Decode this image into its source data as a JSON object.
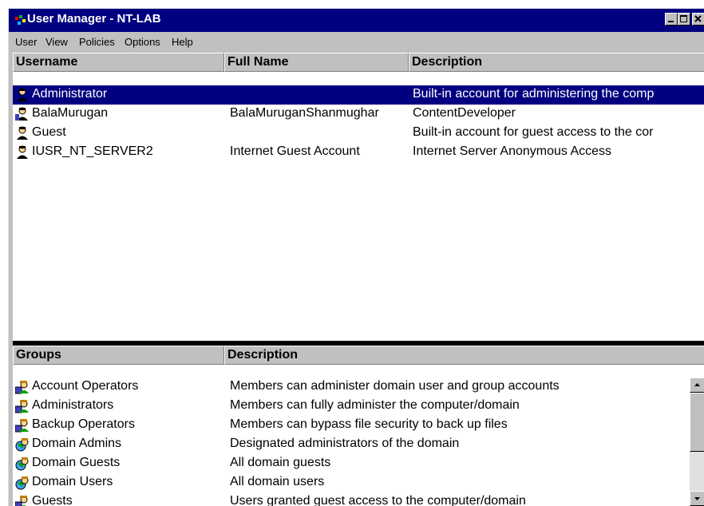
{
  "window": {
    "title": "User Manager - NT-LAB",
    "controls": {
      "minimize_icon": "minimize-icon",
      "maximize_icon": "maximize-icon",
      "close_icon": "close-icon"
    }
  },
  "menu": {
    "items": [
      {
        "label": "User"
      },
      {
        "label": "View"
      },
      {
        "label": "Policies"
      },
      {
        "label": "Options"
      },
      {
        "label": "Help"
      }
    ]
  },
  "users": {
    "columns": [
      "Username",
      "Full Name",
      "Description"
    ],
    "rows": [
      {
        "username": "Administrator",
        "full_name": "",
        "description": "Built-in account for administering the comp",
        "icon": "user-icon",
        "selected": true
      },
      {
        "username": "BalaMurugan",
        "full_name": "BalaMuruganShanmughar",
        "description": "ContentDeveloper",
        "icon": "user-icon",
        "selected": false
      },
      {
        "username": "Guest",
        "full_name": "",
        "description": "Built-in account for guest access to the cor",
        "icon": "user-icon",
        "selected": false
      },
      {
        "username": "IUSR_NT_SERVER2",
        "full_name": "Internet Guest Account",
        "description": "Internet Server Anonymous Access",
        "icon": "user-icon",
        "selected": false
      }
    ]
  },
  "groups": {
    "columns": [
      "Groups",
      "Description"
    ],
    "rows": [
      {
        "name": "Account Operators",
        "description": "Members can administer domain user and group accounts",
        "icon": "local-group-icon"
      },
      {
        "name": "Administrators",
        "description": "Members can fully administer the computer/domain",
        "icon": "local-group-icon"
      },
      {
        "name": "Backup Operators",
        "description": "Members can bypass file security to back up files",
        "icon": "local-group-icon"
      },
      {
        "name": "Domain Admins",
        "description": "Designated administrators of the domain",
        "icon": "global-group-icon"
      },
      {
        "name": "Domain Guests",
        "description": "All domain guests",
        "icon": "global-group-icon"
      },
      {
        "name": "Domain Users",
        "description": "All domain users",
        "icon": "global-group-icon"
      },
      {
        "name": "Guests",
        "description": "Users granted guest access to the computer/domain",
        "icon": "local-group-icon"
      }
    ]
  },
  "colors": {
    "titlebar": "#000080",
    "selection": "#000080",
    "face": "#c0c0c0"
  }
}
